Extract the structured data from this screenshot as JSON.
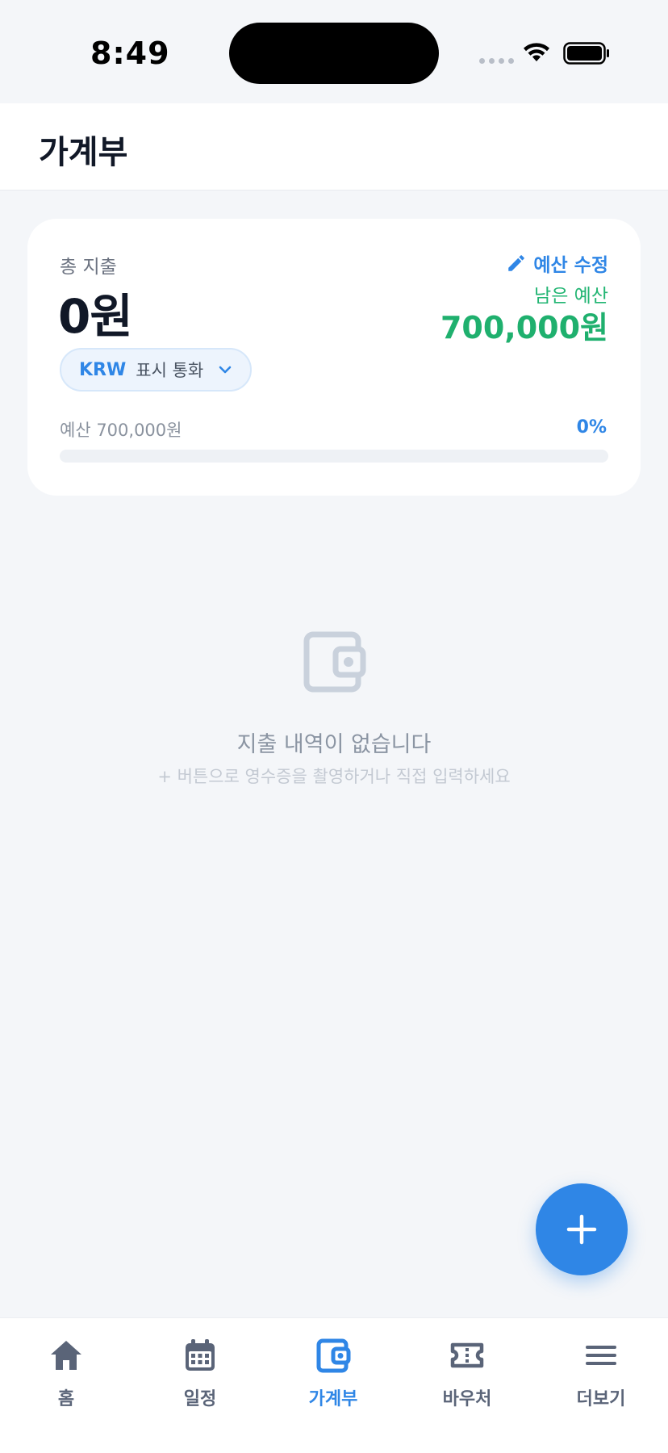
{
  "status_bar": {
    "time": "8:49"
  },
  "header": {
    "title": "가계부"
  },
  "summary": {
    "total_label": "총 지출",
    "total_amount": "0원",
    "edit_budget_label": "예산 수정",
    "remaining_label": "남은 예산",
    "remaining_amount": "700,000원",
    "currency_code": "KRW",
    "currency_label": "표시 통화",
    "budget_label": "예산 700,000원",
    "budget_percent": "0%",
    "budget_used_fraction": 0
  },
  "empty_state": {
    "icon": "wallet-icon",
    "title": "지출 내역이 없습니다",
    "subtitle": "+ 버튼으로 영수증을 촬영하거나 직접 입력하세요"
  },
  "fab": {
    "icon": "plus-icon"
  },
  "nav": {
    "items": [
      {
        "label": "홈",
        "icon": "home-icon"
      },
      {
        "label": "일정",
        "icon": "calendar-icon"
      },
      {
        "label": "가계부",
        "icon": "wallet-icon",
        "active": true
      },
      {
        "label": "바우처",
        "icon": "ticket-icon"
      },
      {
        "label": "더보기",
        "icon": "menu-icon"
      }
    ]
  },
  "colors": {
    "accent": "#2f86e6",
    "remaining": "#1fb06e",
    "background": "#f4f6f9"
  }
}
